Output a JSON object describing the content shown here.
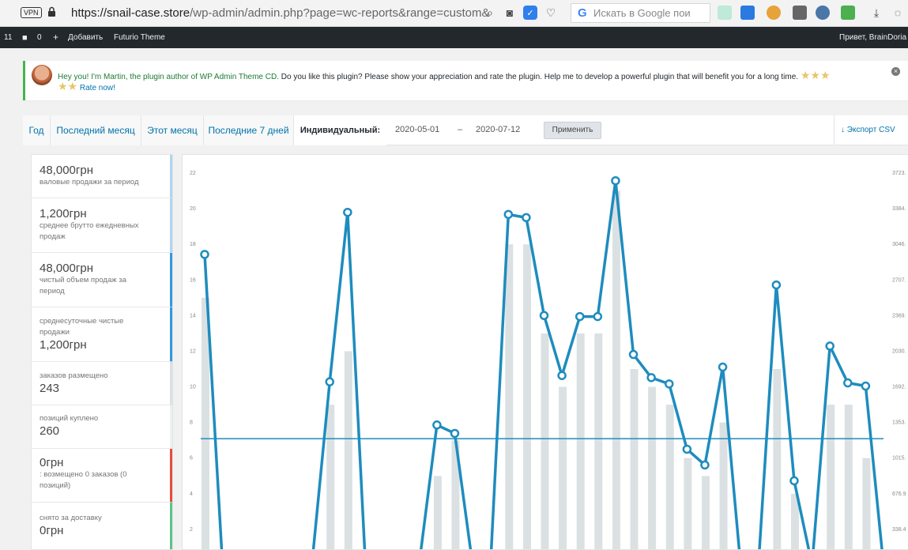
{
  "browser": {
    "vpn_label": "VPN",
    "url_host": "https://snail-case.store",
    "url_path": "/wp-admin/admin.php?page=wc-reports&range=custom&",
    "google_placeholder": "Искать в Google пои"
  },
  "wpbar": {
    "count": "11",
    "comments": "0",
    "add": "Добавить",
    "theme": "Futurio Theme",
    "greeting": "Привет, BrainDoria"
  },
  "notice": {
    "text_main": "Hey you! I'm Martin, the plugin author of WP Admin Theme CD.",
    "text_rest": " Do you like this plugin? Please show your appreciation and rate the plugin. Help me to develop a powerful plugin that will benefit you for a long time.",
    "stars": "★★★",
    "stars2": "★★",
    "rate": "Rate now!"
  },
  "tabs": {
    "year": "Год",
    "last_month": "Последний месяц",
    "this_month": "Этот месяц",
    "last_7": "Последние 7 дней",
    "custom": "Индивидуальный:",
    "date_from": "2020-05-01",
    "dash": "–",
    "date_to": "2020-07-12",
    "apply": "Применить",
    "export": "↓ Экспорт CSV"
  },
  "legend": [
    {
      "value": "48,000грн",
      "label": "валовые продажи за период",
      "color": "#b1d4ea"
    },
    {
      "value": "1,200грн",
      "label": "среднее брутто ежедневных продаж",
      "color": "#b1d4ea"
    },
    {
      "value": "48,000грн",
      "label": "чистый объем продаж за период",
      "color": "#3498db"
    },
    {
      "value": "1,200грн",
      "label": "среднесуточные чистые продажи",
      "color": "#3498db"
    },
    {
      "value": "243",
      "label": "заказов размещено",
      "color": "#dbe1e3"
    },
    {
      "value": "260",
      "label": "позиций куплено",
      "color": "#ecf0f1"
    },
    {
      "value": "0грн",
      "label": ": возмещено 0 заказов (0 позиций)",
      "color": "#e74c3c"
    },
    {
      "value": "0грн",
      "label": "снято за доставку",
      "color": "#5cc488"
    }
  ],
  "chart_data": {
    "type": "bar",
    "left_axis_ticks": [
      "2",
      "4",
      "6",
      "8",
      "10",
      "12",
      "14",
      "16",
      "18",
      "20",
      "22"
    ],
    "right_axis_ticks": [
      "338.4",
      "676.9",
      "1015.",
      "1353.",
      "1692.",
      "2030.",
      "2369.",
      "2707.",
      "3046.",
      "3384.",
      "3723."
    ],
    "bars": [
      15,
      0,
      0,
      0,
      0,
      0,
      0,
      9,
      12,
      0,
      0,
      0,
      0,
      5,
      7,
      0,
      0,
      18,
      18,
      13,
      10,
      13,
      13,
      21,
      11,
      10,
      9,
      6,
      5,
      8,
      0,
      0,
      11,
      4,
      0,
      9,
      9,
      6,
      0
    ],
    "line_sales": [
      2950,
      0,
      0,
      0,
      0,
      0,
      0,
      1740,
      3350,
      0,
      0,
      0,
      0,
      1330,
      1250,
      0,
      0,
      3330,
      3300,
      2370,
      1800,
      2360,
      2360,
      3650,
      2000,
      1780,
      1720,
      1100,
      950,
      1880,
      0,
      0,
      2660,
      800,
      0,
      2080,
      1730,
      1700,
      0
    ],
    "average_sales": 1200,
    "colors": {
      "bars": "#dbe1e3",
      "line": "#1e8cbe",
      "avg": "#1e8cbe"
    }
  }
}
